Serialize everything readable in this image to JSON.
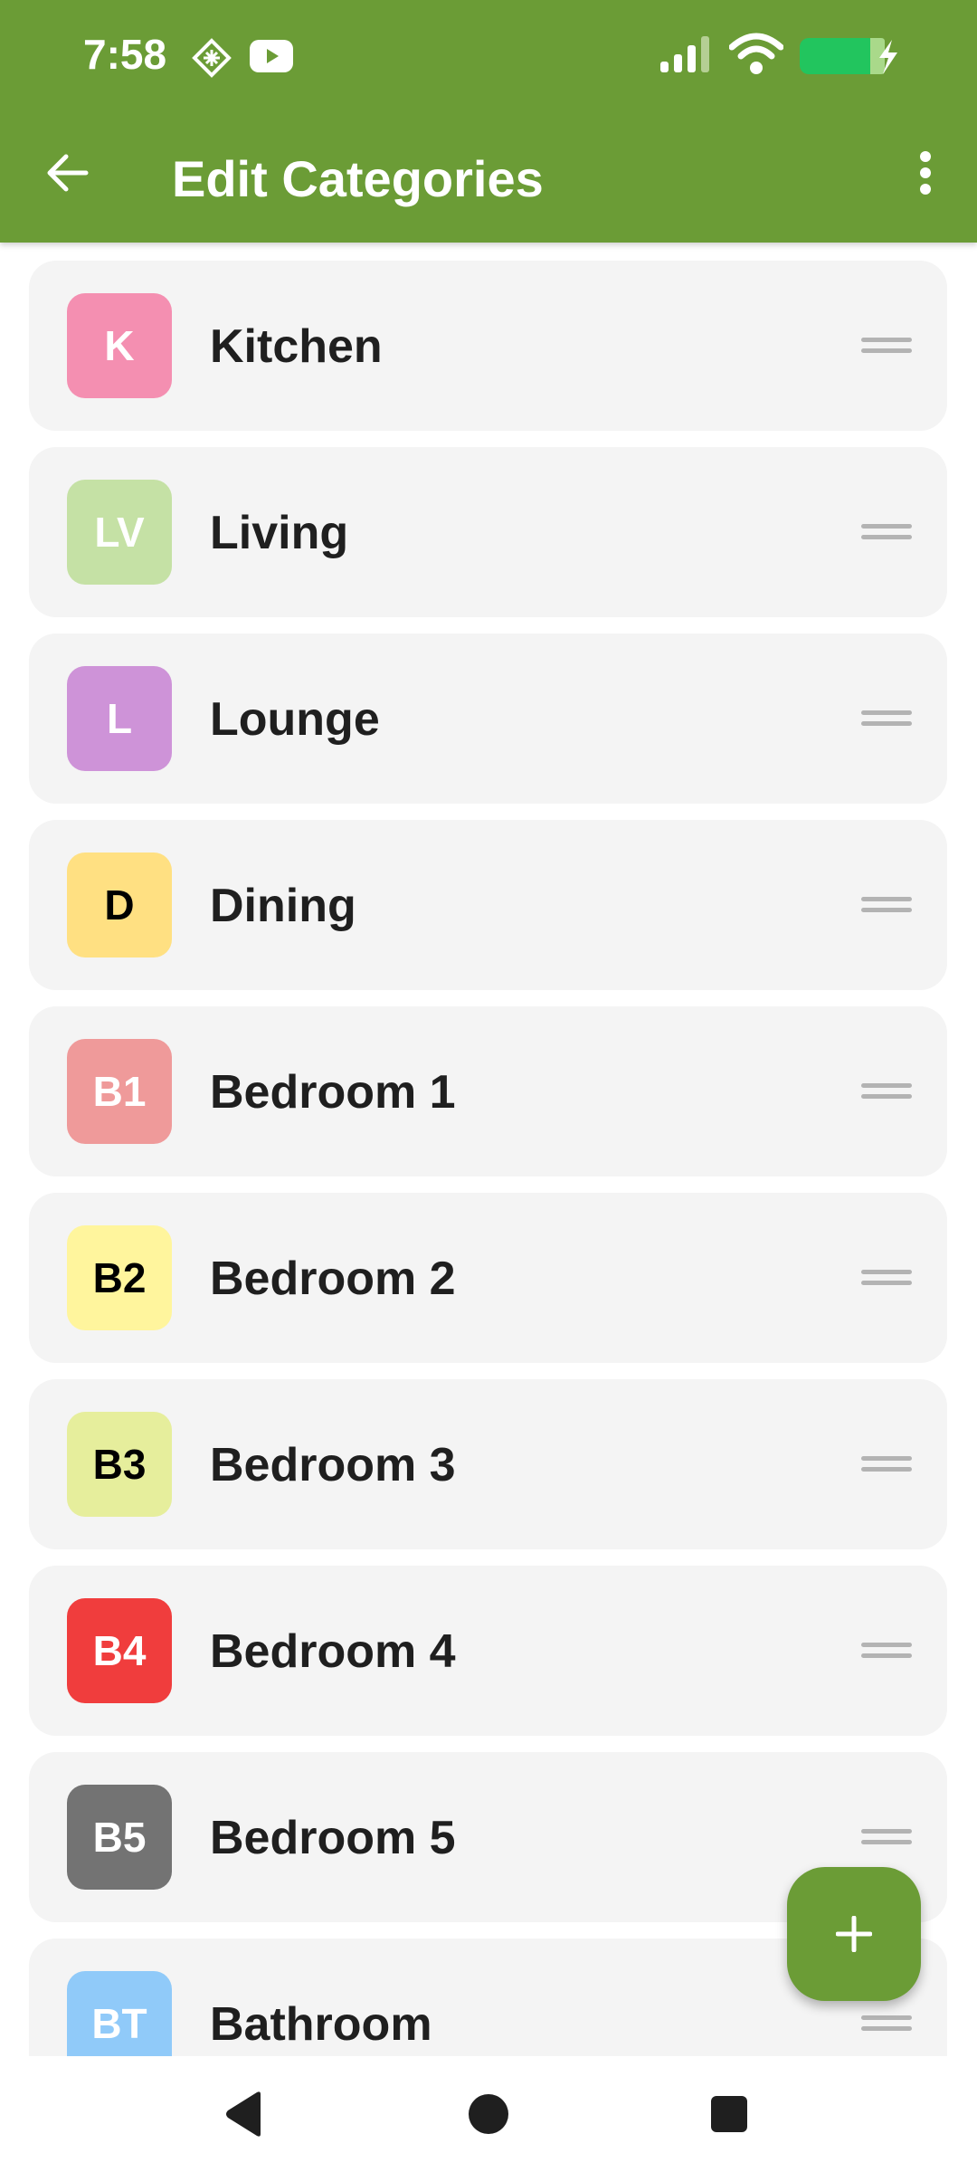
{
  "status_bar": {
    "time": "7:58",
    "icons": [
      "authenticator-icon",
      "youtube-icon",
      "cellular-signal-icon",
      "wifi-icon",
      "battery-charging-icon"
    ],
    "battery_color": "#22c55e"
  },
  "app_bar": {
    "title": "Edit Categories",
    "back_icon": "arrow-left-icon",
    "menu_icon": "more-vert-icon",
    "color": "#6b9c36"
  },
  "categories": [
    {
      "initials": "K",
      "name": "Kitchen",
      "color": "#f48fb1",
      "text_color": "#ffffff"
    },
    {
      "initials": "LV",
      "name": "Living",
      "color": "#c5e1a5",
      "text_color": "#ffffff"
    },
    {
      "initials": "L",
      "name": "Lounge",
      "color": "#ce93d8",
      "text_color": "#ffffff"
    },
    {
      "initials": "D",
      "name": "Dining",
      "color": "#ffe082",
      "text_color": "#000000"
    },
    {
      "initials": "B1",
      "name": "Bedroom 1",
      "color": "#ef9a9a",
      "text_color": "#ffffff"
    },
    {
      "initials": "B2",
      "name": "Bedroom 2",
      "color": "#fff59d",
      "text_color": "#000000"
    },
    {
      "initials": "B3",
      "name": "Bedroom 3",
      "color": "#e6ee9c",
      "text_color": "#000000"
    },
    {
      "initials": "B4",
      "name": "Bedroom 4",
      "color": "#f03d3d",
      "text_color": "#ffffff"
    },
    {
      "initials": "B5",
      "name": "Bedroom 5",
      "color": "#737373",
      "text_color": "#ffffff"
    },
    {
      "initials": "BT",
      "name": "Bathroom",
      "color": "#90caf9",
      "text_color": "#ffffff"
    }
  ],
  "fab": {
    "icon": "plus-icon",
    "color": "#6b9c36"
  },
  "nav_bar": {
    "icons": [
      "nav-back-icon",
      "nav-home-icon",
      "nav-recents-icon"
    ]
  }
}
